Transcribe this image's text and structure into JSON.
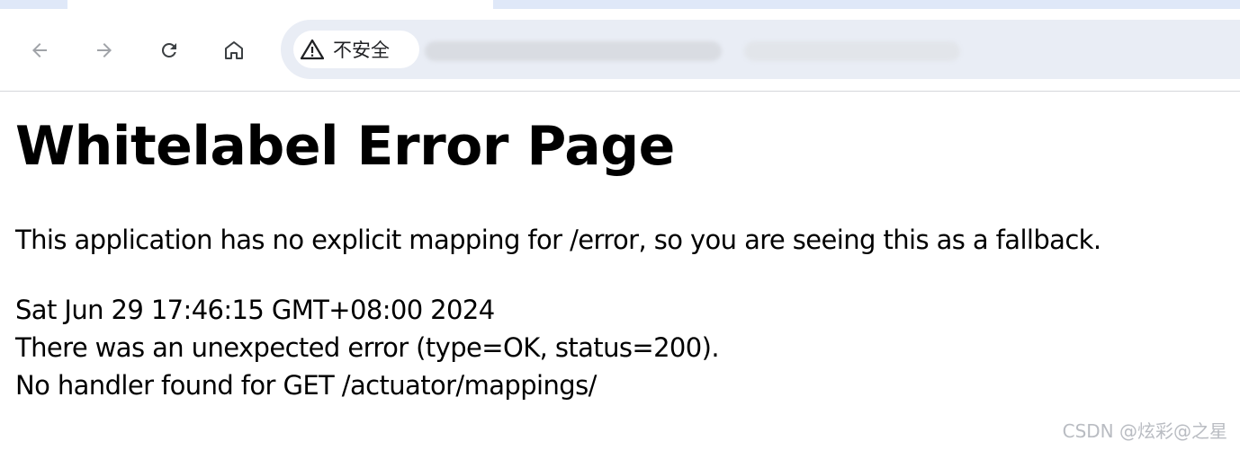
{
  "browser": {
    "security_label": "不安全",
    "buttons": {
      "back": "back-arrow-icon",
      "forward": "forward-arrow-icon",
      "reload": "reload-icon",
      "home": "home-icon"
    }
  },
  "page": {
    "title": "Whitelabel Error Page",
    "message": "This application has no explicit mapping for /error, so you are seeing this as a fallback.",
    "error_lines": [
      "Sat Jun 29 17:46:15 GMT+08:00 2024",
      "There was an unexpected error (type=OK, status=200).",
      "No handler found for GET /actuator/mappings/"
    ]
  },
  "watermark": "CSDN @炫彩@之星",
  "colors": {
    "tab_strip": "#dfe8f8",
    "omnibox": "#e9edf5",
    "icon": "#5f6368",
    "icon_disabled": "#a0a3a8"
  }
}
